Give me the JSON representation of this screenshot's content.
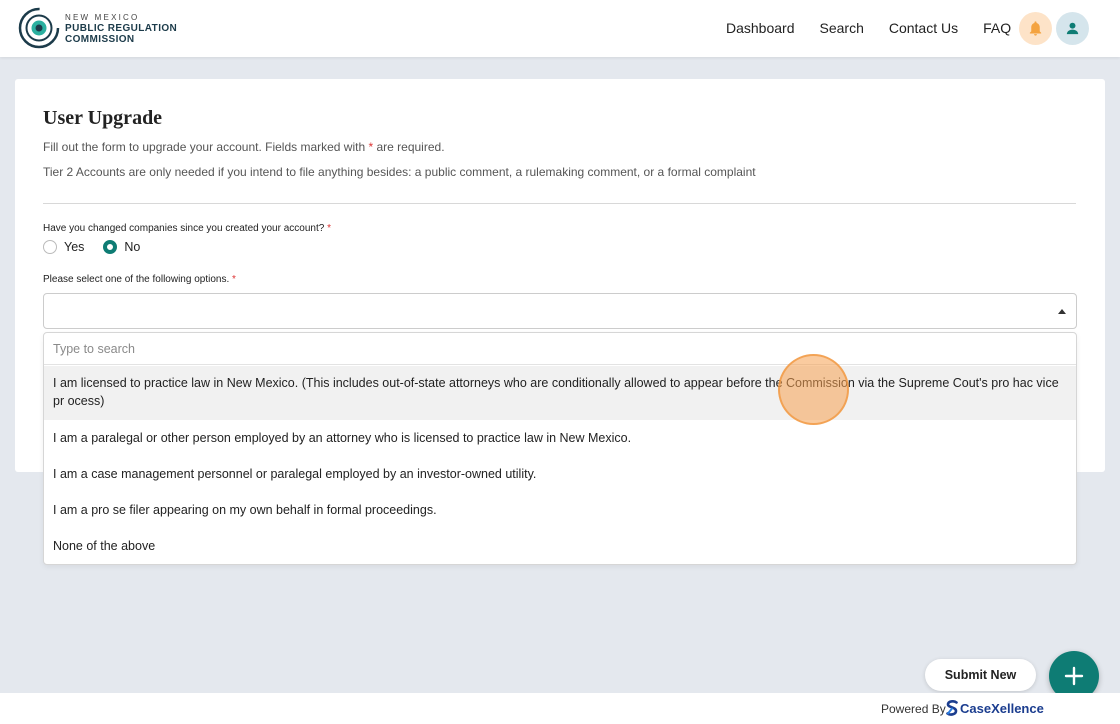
{
  "header": {
    "logo": {
      "line1": "NEW MEXICO",
      "line2": "PUBLIC REGULATION",
      "line3": "COMMISSION"
    },
    "nav": [
      "Dashboard",
      "Search",
      "Contact Us",
      "FAQ"
    ],
    "icons": {
      "notifications": "bell-icon",
      "account": "user-icon"
    },
    "colors": {
      "bell_bg": "#fde3c8",
      "user_bg": "#d5e5ec"
    }
  },
  "form": {
    "title": "User Upgrade",
    "desc1_prefix": "Fill out the form to upgrade your account. Fields marked with ",
    "required_mark": "*",
    "desc1_suffix": " are required.",
    "desc2": "Tier 2 Accounts are only needed if you intend to file anything besides: a public comment, a rulemaking comment, or a formal complaint",
    "q1": {
      "label": "Have you changed companies since you created your account?",
      "options": [
        "Yes",
        "No"
      ],
      "selected": "No"
    },
    "q2": {
      "label": "Please select one of the following options.",
      "value": ""
    }
  },
  "dropdown": {
    "search_placeholder": "Type to search",
    "options": [
      "I am licensed to practice law in New Mexico. (This includes out-of-state attorneys who are conditionally allowed to appear before the Commission via the Supreme Cout's pro hac vice pr ocess)",
      "I am a paralegal or other person employed by an attorney who is licensed to practice law in New Mexico.",
      "I am a case management personnel or paralegal employed by an investor-owned utility.",
      "I am a pro se filer appearing on my own behalf in formal proceedings.",
      "None of the above"
    ],
    "highlighted_index": 0
  },
  "actions": {
    "submit_new": "Submit New",
    "fab_icon": "plus-icon"
  },
  "footer": {
    "powered_by": "Powered By",
    "brand": "CaseXellence"
  },
  "colors": {
    "accent": "#0e7c74",
    "required": "#d33333",
    "brand": "#1b3d8f"
  }
}
